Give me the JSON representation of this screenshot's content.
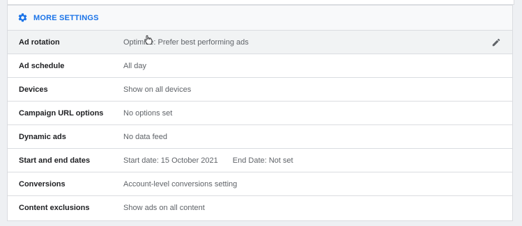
{
  "section": {
    "title": "MORE SETTINGS",
    "icon": "gear-icon",
    "accent_color": "#1a73e8"
  },
  "settings": [
    {
      "label": "Ad rotation",
      "value": "Optimise: Prefer best performing ads",
      "editable": true
    },
    {
      "label": "Ad schedule",
      "value": "All day"
    },
    {
      "label": "Devices",
      "value": "Show on all devices"
    },
    {
      "label": "Campaign URL options",
      "value": "No options set"
    },
    {
      "label": "Dynamic ads",
      "value": "No data feed"
    },
    {
      "label": "Start and end dates",
      "value_start": "Start date: 15 October 2021",
      "value_end": "End Date: Not set"
    },
    {
      "label": "Conversions",
      "value": "Account-level conversions setting"
    },
    {
      "label": "Content exclusions",
      "value": "Show ads on all content"
    }
  ],
  "icons": {
    "edit": "pencil-icon",
    "cursor": "hand-pointer-icon"
  }
}
